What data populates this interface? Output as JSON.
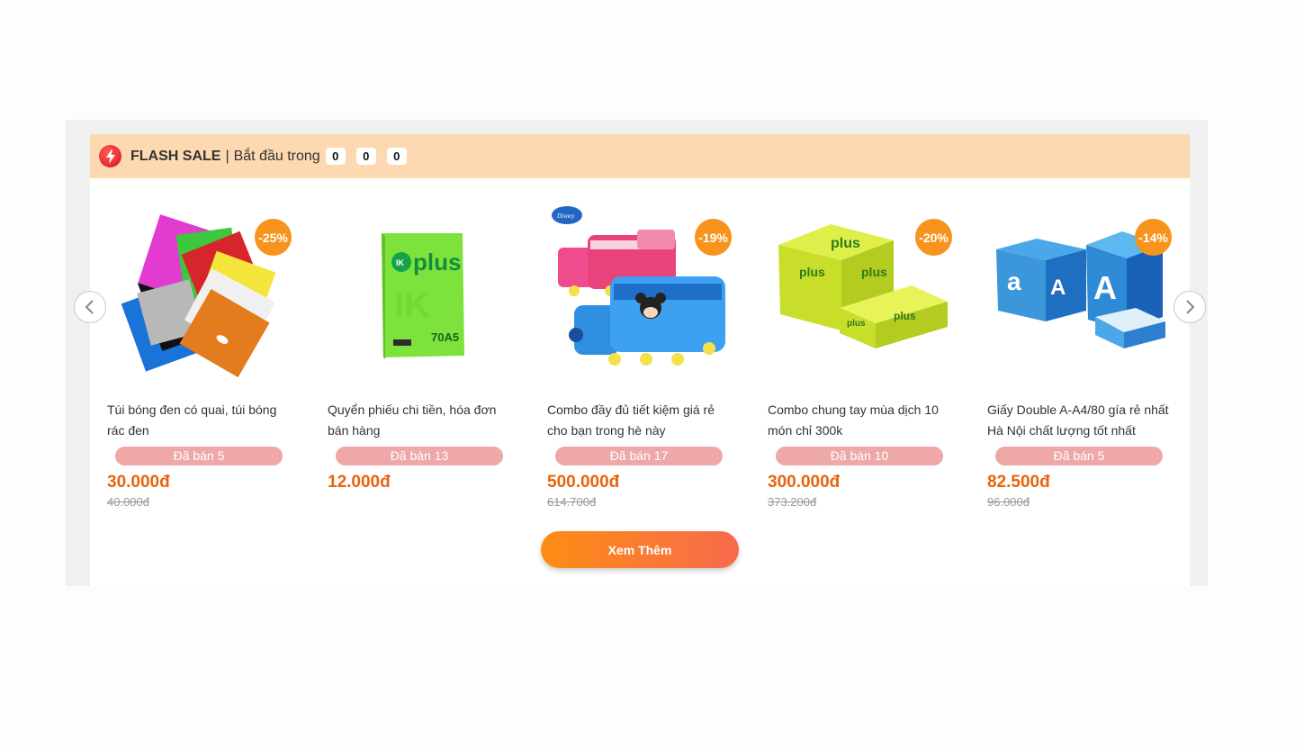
{
  "flash_sale": {
    "title": "FLASH SALE",
    "separator": "|",
    "starts_in_label": "Bắt đầu trong",
    "countdown": [
      "0",
      "0",
      "0"
    ],
    "icon": "lightning-bolt-icon",
    "header_color": "#fcd9b0"
  },
  "navigation": {
    "prev_icon": "chevron-left-icon",
    "next_icon": "chevron-right-icon"
  },
  "products": [
    {
      "name": "Túi bóng đen có quai, túi bóng rác đen",
      "discount": "-25%",
      "sold": "Đã bán 5",
      "price": "30.000đ",
      "old_price": "40.000đ",
      "image": "colorful-plastic-bags"
    },
    {
      "name": "Quyển phiếu chi tiền, hóa đơn bán hàng",
      "discount": "",
      "sold": "Đã bán 13",
      "price": "12.000đ",
      "old_price": "",
      "image": "ik-plus-paper-ream"
    },
    {
      "name": "Combo đầy đủ tiết kiệm giá rẻ cho bạn trong hè này",
      "discount": "-19%",
      "sold": "Đã bán 17",
      "price": "500.000đ",
      "old_price": "614.700đ",
      "image": "disney-train-pencil-cases"
    },
    {
      "name": "Combo chung tay mùa dịch 10 món chỉ 300k",
      "discount": "-20%",
      "sold": "Đã bán 10",
      "price": "300.000đ",
      "old_price": "373.200đ",
      "image": "ik-plus-paper-boxes"
    },
    {
      "name": "Giấy Double A-A4/80 gía rẻ nhất Hà Nội chất lượng tốt nhất",
      "discount": "-14%",
      "sold": "Đã bán 5",
      "price": "82.500đ",
      "old_price": "96.000đ",
      "image": "double-a-paper-boxes"
    }
  ],
  "more_button": {
    "label": "Xem Thêm"
  },
  "colors": {
    "accent": "#f7941d",
    "price": "#e8640c",
    "sold_badge": "#eea8a8"
  }
}
